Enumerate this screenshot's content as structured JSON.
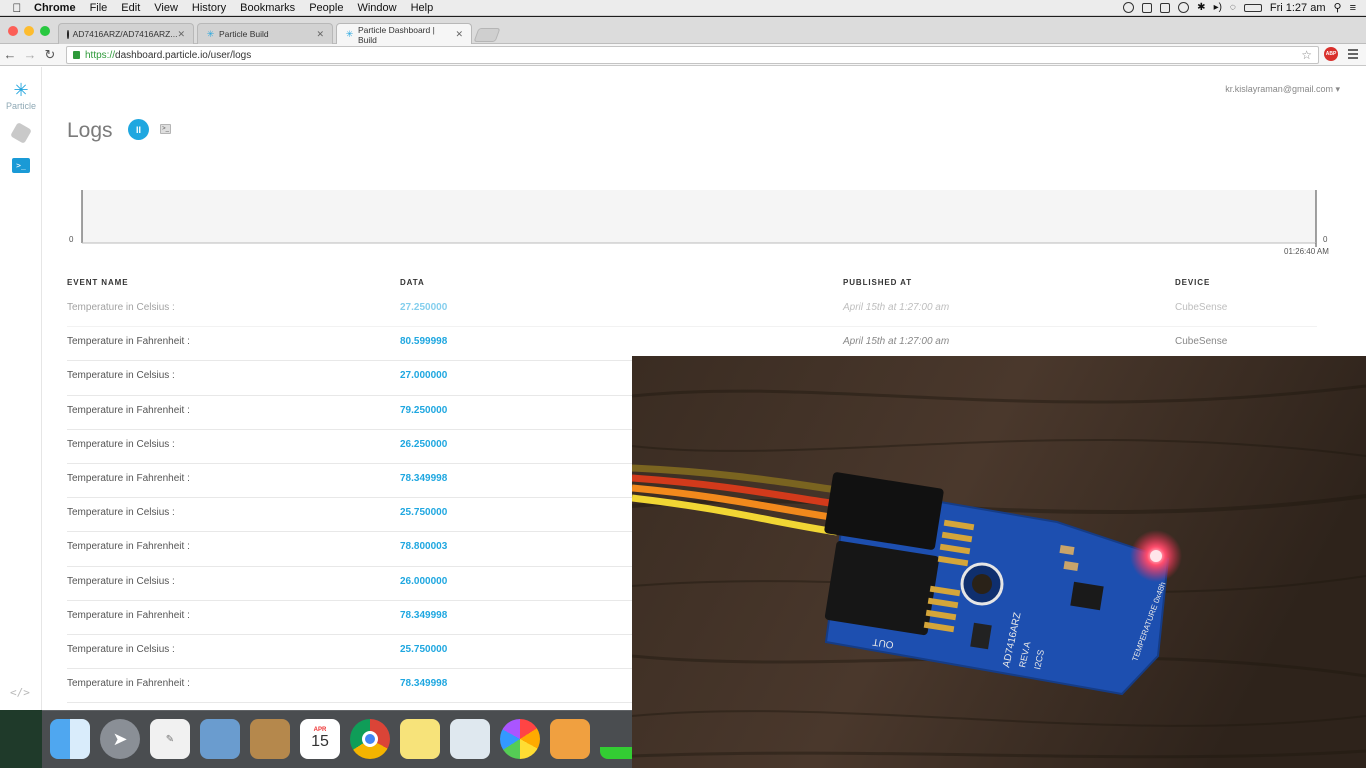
{
  "menubar": {
    "app": "Chrome",
    "items": [
      "File",
      "Edit",
      "View",
      "History",
      "Bookmarks",
      "People",
      "Window",
      "Help"
    ],
    "clock": "Fri 1:27 am"
  },
  "browser": {
    "tabs": [
      {
        "label": "AD7416ARZ/AD7416ARZ...",
        "icon": "github-icon"
      },
      {
        "label": "Particle Build",
        "icon": "particle-icon"
      },
      {
        "label": "Particle Dashboard | Build",
        "icon": "particle-icon"
      }
    ],
    "url_protocol": "https://",
    "url_rest": "dashboard.particle.io/user/logs",
    "abp_label": "ABP"
  },
  "sidebar": {
    "brand_label": "Particle"
  },
  "header": {
    "user_email": "kr.kislayraman@gmail.com",
    "page_title": "Logs"
  },
  "chart_data": {
    "type": "line",
    "y_min_label": "0",
    "y_min_label_right": "0",
    "x_tick_label": "01:26:40 AM",
    "values": []
  },
  "table": {
    "headers": {
      "event": "EVENT NAME",
      "data": "DATA",
      "published": "PUBLISHED AT",
      "device": "DEVICE"
    },
    "rows": [
      {
        "event": "Temperature in Celsius :",
        "data": "27.250000",
        "published": "April 15th at 1:27:00 am",
        "device": "CubeSense"
      },
      {
        "event": "Temperature in Fahrenheit :",
        "data": "80.599998",
        "published": "April 15th at 1:27:00 am",
        "device": "CubeSense"
      },
      {
        "event": "Temperature in Celsius :",
        "data": "27.000000",
        "published": "",
        "device": ""
      },
      {
        "event": "Temperature in Fahrenheit :",
        "data": "79.250000",
        "published": "",
        "device": ""
      },
      {
        "event": "Temperature in Celsius :",
        "data": "26.250000",
        "published": "",
        "device": ""
      },
      {
        "event": "Temperature in Fahrenheit :",
        "data": "78.349998",
        "published": "",
        "device": ""
      },
      {
        "event": "Temperature in Celsius :",
        "data": "25.750000",
        "published": "",
        "device": ""
      },
      {
        "event": "Temperature in Fahrenheit :",
        "data": "78.800003",
        "published": "",
        "device": ""
      },
      {
        "event": "Temperature in Celsius :",
        "data": "26.000000",
        "published": "",
        "device": ""
      },
      {
        "event": "Temperature in Fahrenheit :",
        "data": "78.349998",
        "published": "",
        "device": ""
      },
      {
        "event": "Temperature in Celsius :",
        "data": "25.750000",
        "published": "",
        "device": ""
      },
      {
        "event": "Temperature in Fahrenheit :",
        "data": "78.349998",
        "published": "",
        "device": ""
      }
    ]
  },
  "video": {
    "board_text_1": "AD7416ARZ",
    "board_text_2": "REV.A",
    "board_text_3": "I2CS",
    "board_text_4": "TEMPERATURE 0x48h",
    "board_text_5": "OUT"
  },
  "dock": {
    "calendar_month": "APR",
    "calendar_day": "15"
  },
  "colors": {
    "accent": "#1fa7e0",
    "board": "#1d4fb0",
    "wood": "#3b2c22"
  }
}
